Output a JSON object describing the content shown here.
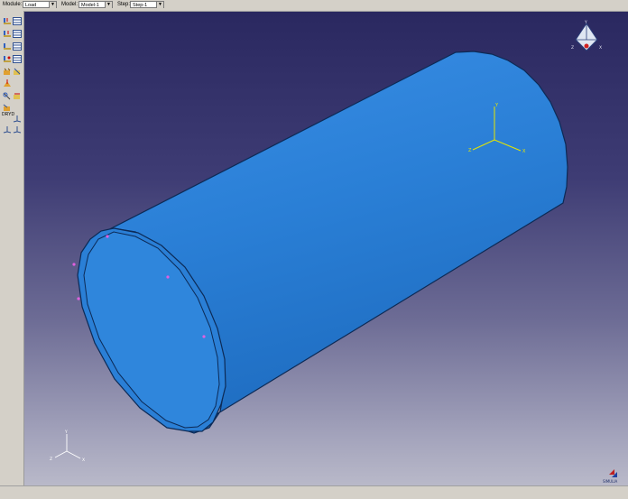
{
  "context_bar": {
    "module": {
      "label": "Module:",
      "value": "Load"
    },
    "model": {
      "label": "Model:",
      "value": "Model-1"
    },
    "step": {
      "label": "Step:",
      "value": "Step-1"
    }
  },
  "toolbox": {
    "icons": [
      "load-manager-icon",
      "bc-manager-icon",
      "create-load-icon",
      "create-bc-icon",
      "predefined-field-icon",
      "field-manager-icon",
      "load-case-icon",
      "load-case-manager-icon",
      "create-constraint-icon",
      "constraint-manager-icon",
      "create-load-small-icon",
      "query-tool-icon",
      "amplitude-icon",
      "assign-icon",
      "create-datum-icon",
      "datum-csys-icon",
      "csys-manager-icon",
      "datum-axis-icon"
    ],
    "wire_label": "DRYD"
  },
  "viewport": {
    "part": "pipe",
    "part_color": "#2a7fd6",
    "triad_labels": {
      "x": "X",
      "y": "Y",
      "z": "Z"
    },
    "csys_labels": {
      "x": "X",
      "y": "Y",
      "z": "Z"
    },
    "view_cube_labels": {
      "x": "X",
      "y": "Y",
      "z": "Z"
    }
  },
  "branding": {
    "logo_text": "SIMULIA"
  },
  "colors": {
    "background_top": "#2a2860",
    "background_bottom": "#b9b9c9",
    "csys": "#e6e600",
    "markers": "#e060e0"
  }
}
